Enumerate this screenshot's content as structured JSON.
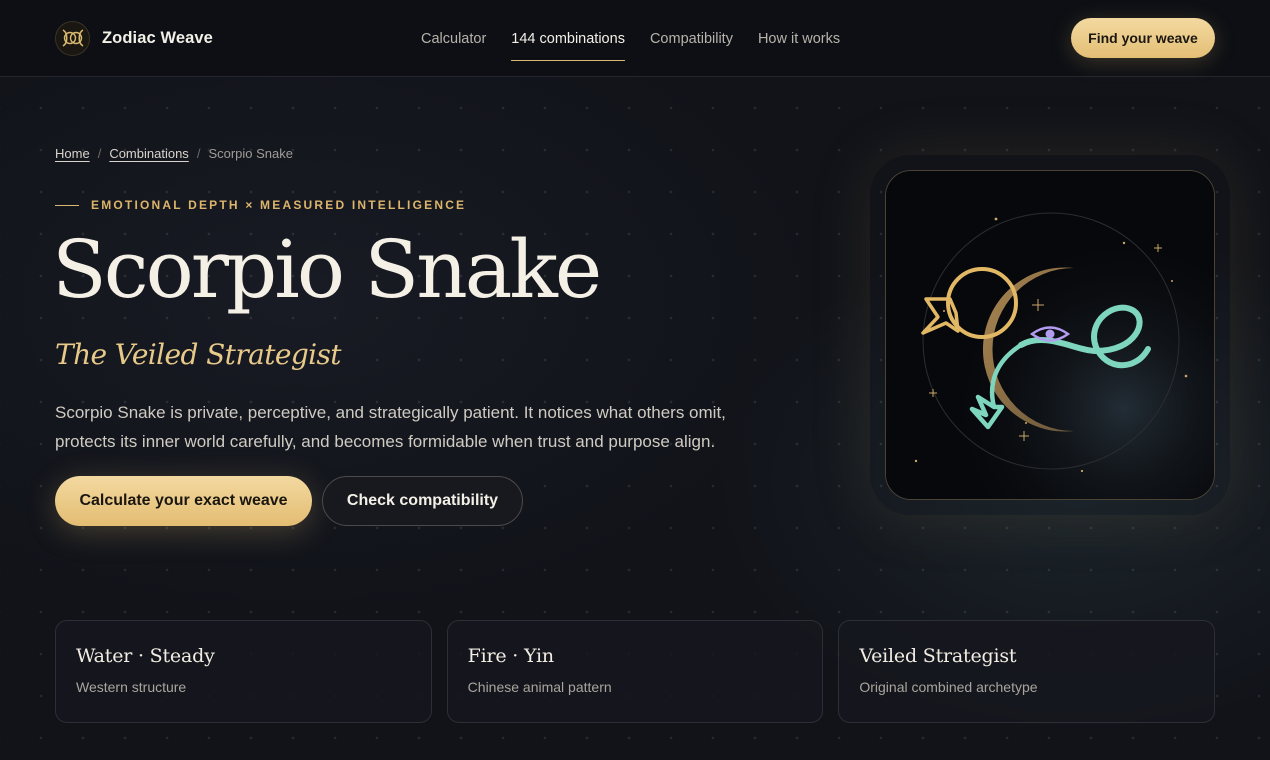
{
  "brand": {
    "name": "Zodiac Weave",
    "logo_icon": "twin-crescent-icon"
  },
  "nav": {
    "items": [
      {
        "label": "Calculator",
        "active": false
      },
      {
        "label": "144 combinations",
        "active": true
      },
      {
        "label": "Compatibility",
        "active": false
      },
      {
        "label": "How it works",
        "active": false
      }
    ],
    "cta_label": "Find your weave"
  },
  "breadcrumb": {
    "home": "Home",
    "sep": "/",
    "combinations": "Combinations",
    "current": "Scorpio Snake"
  },
  "hero": {
    "eyebrow": "EMOTIONAL DEPTH × MEASURED INTELLIGENCE",
    "title": "Scorpio Snake",
    "subtitle": "The Veiled Strategist",
    "lead": "Scorpio Snake is private, perceptive, and strategically patient. It notices what others omit, protects its inner world carefully, and becomes formidable when trust and purpose align.",
    "primary_cta": "Calculate your exact weave",
    "secondary_cta": "Check compatibility",
    "art_icon": "scorpio-snake-emblem-icon"
  },
  "cards": [
    {
      "title": "Water · Steady",
      "subtitle": "Western structure"
    },
    {
      "title": "Fire · Yin",
      "subtitle": "Chinese animal pattern"
    },
    {
      "title": "Veiled Strategist",
      "subtitle": "Original combined archetype"
    }
  ],
  "colors": {
    "accent_gold": "#e4bf75",
    "serpent_teal": "#7fd6bf",
    "eye_violet": "#b39bf0",
    "background": "#111319"
  }
}
